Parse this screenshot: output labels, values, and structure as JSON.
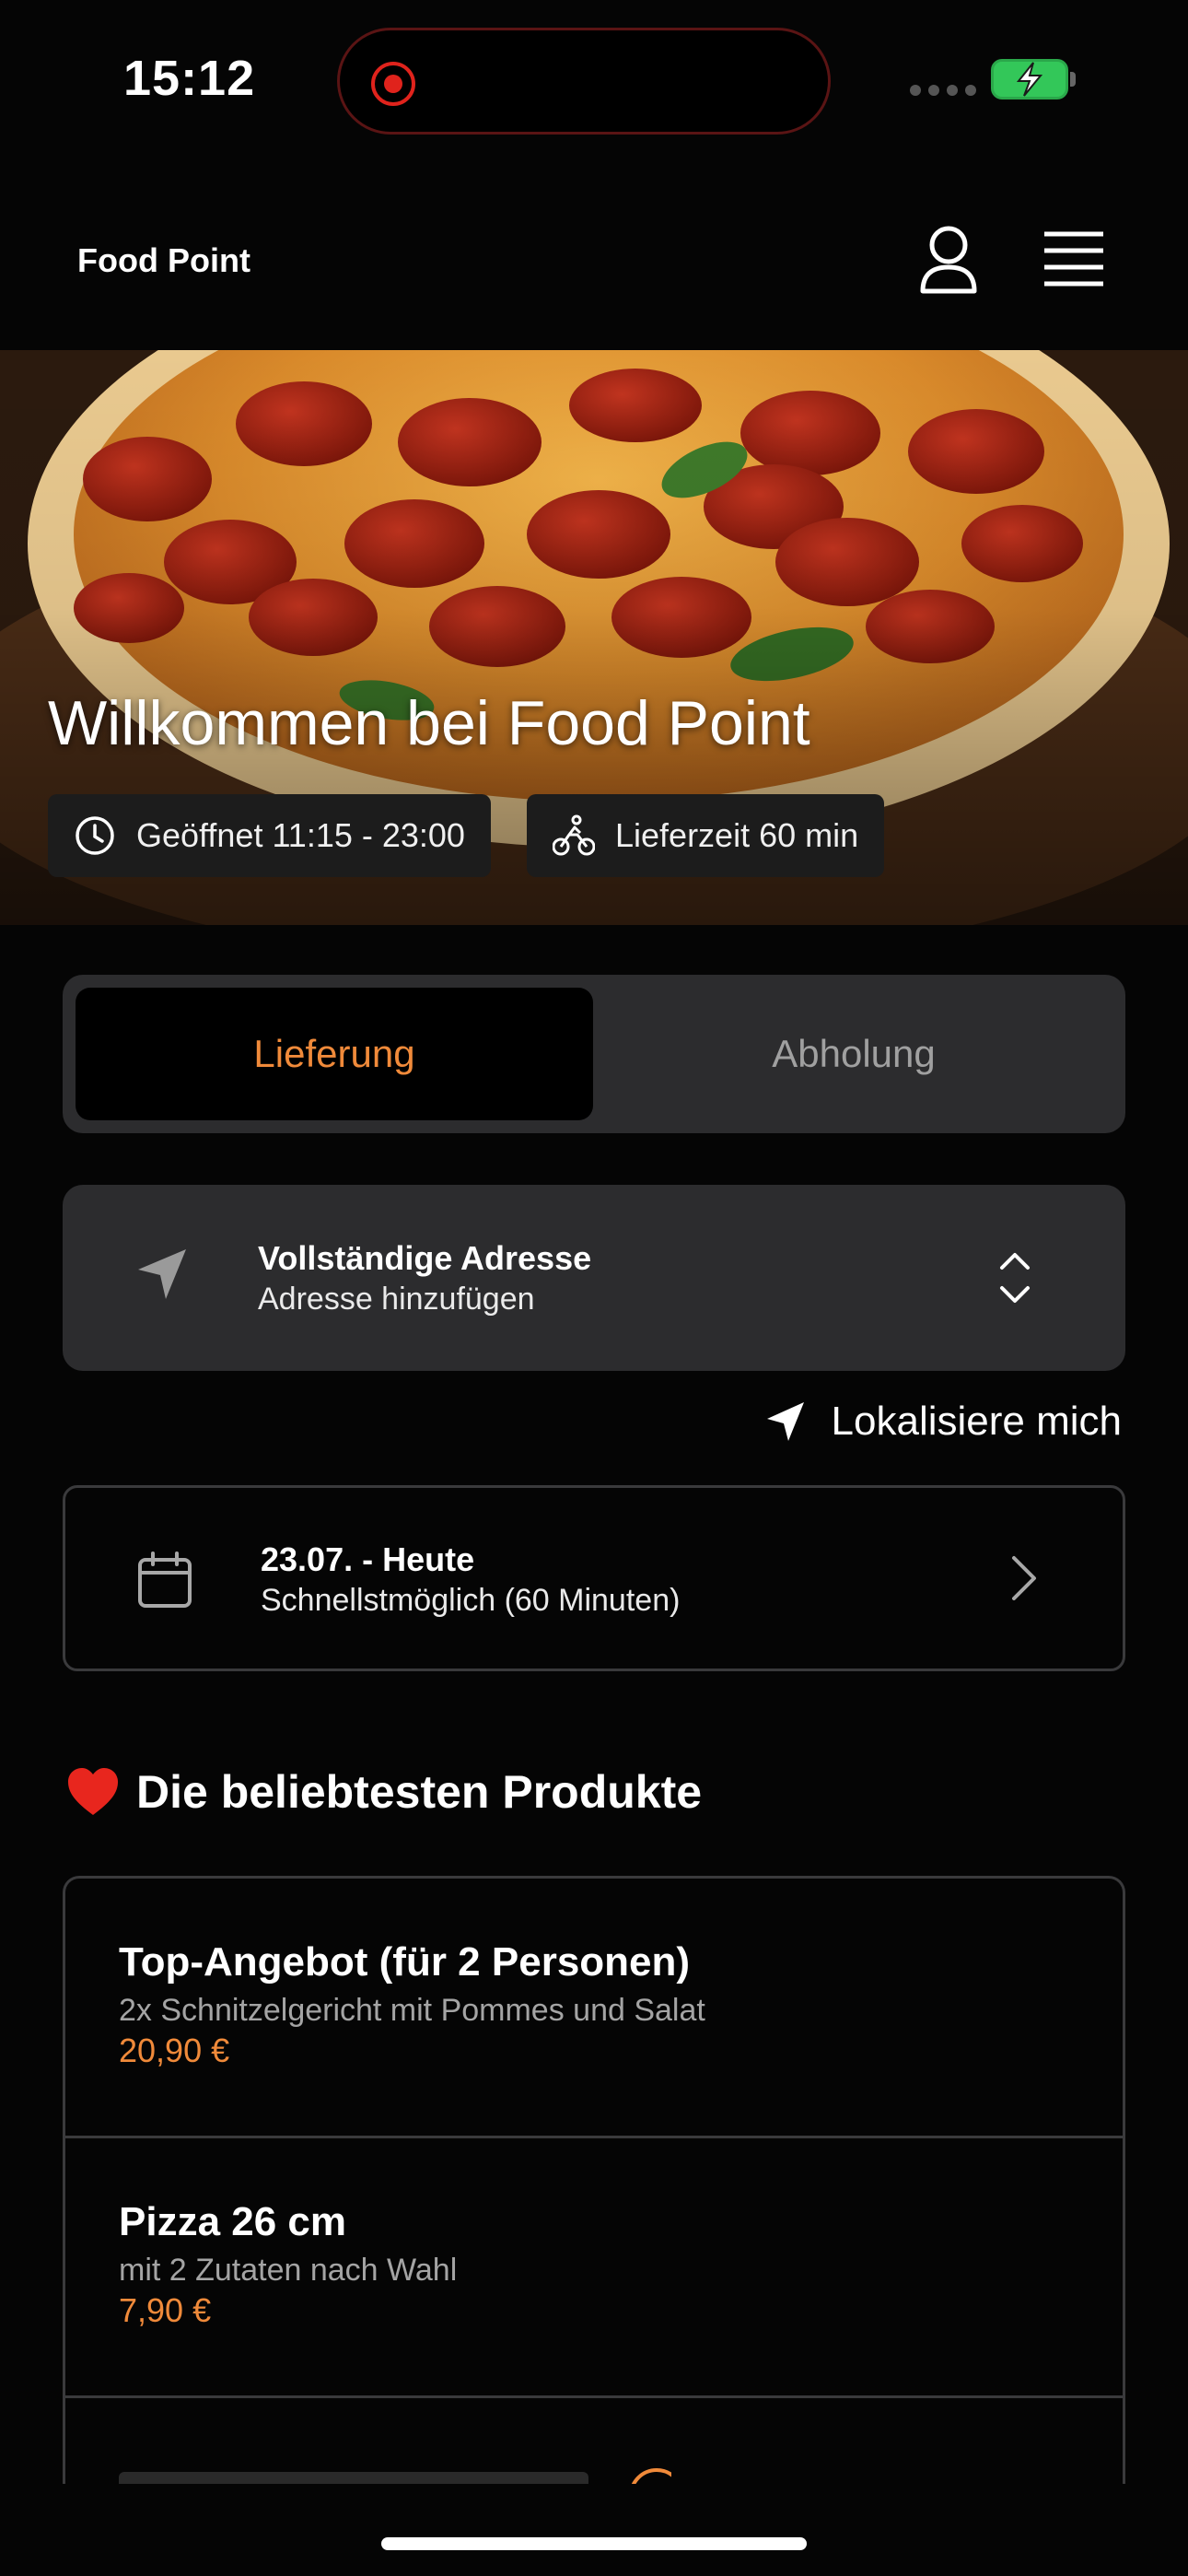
{
  "status_bar": {
    "time": "15:12"
  },
  "header": {
    "brand": "Food Point",
    "icons": [
      "user-icon",
      "hamburger-menu-icon"
    ]
  },
  "hero": {
    "title": "Willkommen bei Food Point",
    "opening_hours": "Geöffnet 11:15 - 23:00",
    "delivery_time": "Lieferzeit 60 min"
  },
  "mode_toggle": {
    "delivery": "Lieferung",
    "pickup": "Abholung",
    "selected": "Lieferung"
  },
  "address": {
    "title": "Vollständige Adresse",
    "subtitle": "Adresse hinzufügen"
  },
  "locate_label": "Lokalisiere mich",
  "schedule": {
    "date": "23.07. - Heute",
    "time": "Schnellstmöglich (60 Minuten)"
  },
  "popular": {
    "emoji": "❤️",
    "title": "Die beliebtesten Produkte",
    "items": [
      {
        "name": "Top-Angebot (für 2 Personen)",
        "description": "2x Schnitzelgericht mit Pommes und Salat",
        "price": "20,90 €"
      },
      {
        "name": "Pizza 26 cm",
        "description": "mit 2 Zutaten nach Wahl",
        "price": "7,90 €"
      }
    ]
  },
  "colors": {
    "accent": "#f08a3a",
    "background": "#050505",
    "card": "#2c2c2e",
    "battery": "#33c759",
    "recording": "#e0231c"
  }
}
